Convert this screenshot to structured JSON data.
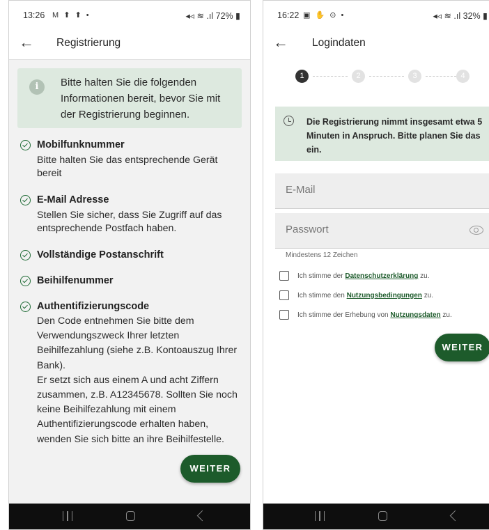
{
  "left_screen": {
    "statusbar": {
      "time": "13:26",
      "icons": "M ⬆ ⬆ •",
      "right": "◂◃ ≋ .ıl 72% ▮"
    },
    "title": "Registrierung",
    "info": "Bitte halten Sie die folgenden Informationen bereit, bevor Sie mit der Registrierung beginnen.",
    "items": [
      {
        "title": "Mobilfunknummer",
        "desc": "Bitte halten Sie das entsprechende Gerät bereit"
      },
      {
        "title": "E-Mail Adresse",
        "desc": "Stellen Sie sicher, dass Sie Zugriff auf das entsprechende Postfach haben."
      },
      {
        "title": "Vollständige Postanschrift"
      },
      {
        "title": "Beihilfenummer"
      },
      {
        "title": "Authentifizierungscode",
        "desc": "Den Code entnehmen Sie bitte dem Verwendungszweck Ihrer letzten Beihilfezahlung (siehe z.B. Kontoauszug Ihrer Bank).",
        "desc2": "Er setzt sich aus einem A und acht Ziffern zusammen, z.B. A12345678. Sollten Sie noch keine Beihilfezahlung mit einem Authentifizierungscode erhalten haben, wenden Sie sich bitte an ihre Beihilfestelle."
      }
    ],
    "button": "WEITER"
  },
  "right_screen": {
    "statusbar": {
      "time": "16:22",
      "icons": "▣ ✋ ⊙ •",
      "right": "◂◃ ≋ .ıl 32% ▮"
    },
    "title": "Logindaten",
    "steps": [
      "1",
      "2",
      "3",
      "4"
    ],
    "active_step": 1,
    "info": "Die Registrierung nimmt insgesamt etwa 5 Minuten in Anspruch. Bitte planen Sie das ein.",
    "email_label": "E-Mail",
    "password_label": "Passwort",
    "password_hint": "Mindestens 12 Zeichen",
    "checkboxes": [
      {
        "pre": "Ich stimme der ",
        "link": "Datenschutzerklärung",
        "post": " zu."
      },
      {
        "pre": "Ich stimme den ",
        "link": "Nutzungsbedingungen",
        "post": " zu."
      },
      {
        "pre": "Ich stimme der Erhebung von ",
        "link": "Nutzungsdaten",
        "post": " zu."
      }
    ],
    "button": "WEITER"
  }
}
